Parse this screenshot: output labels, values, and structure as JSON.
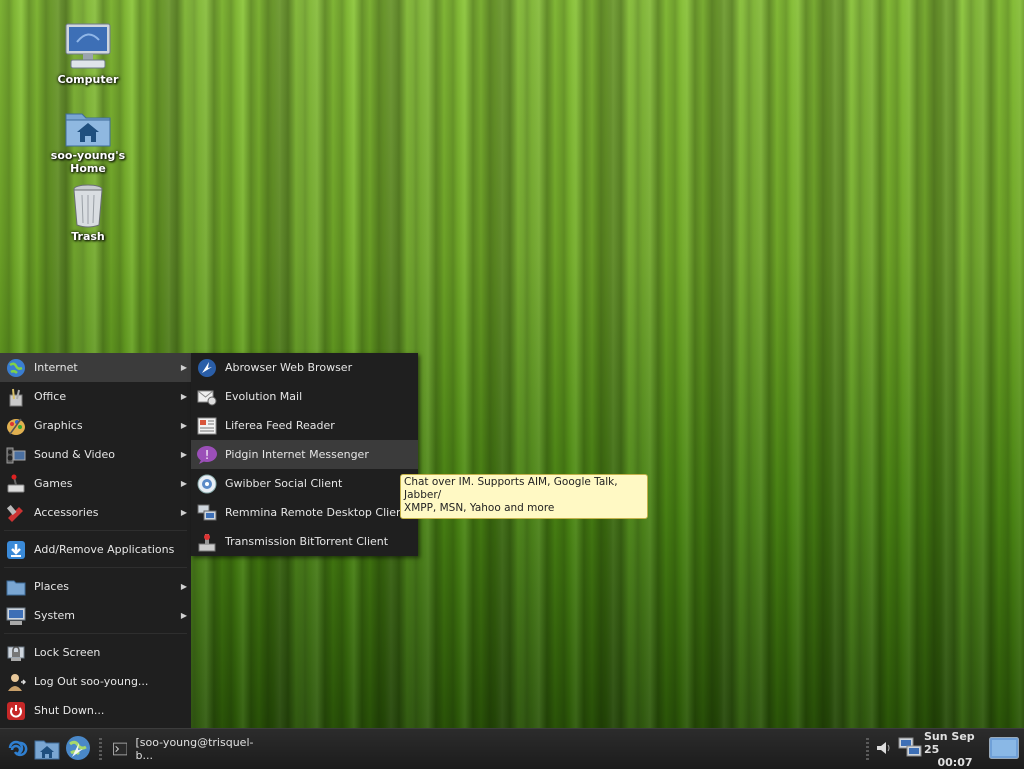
{
  "desktop": {
    "icons": [
      {
        "label": "Computer",
        "icon": "computer-icon"
      },
      {
        "label": "soo-young's Home",
        "icon": "home-folder-icon"
      },
      {
        "label": "Trash",
        "icon": "trash-icon"
      }
    ]
  },
  "main_menu": {
    "items": [
      {
        "label": "Internet",
        "icon": "globe-icon",
        "has_submenu": true
      },
      {
        "label": "Office",
        "icon": "office-icon",
        "has_submenu": true
      },
      {
        "label": "Graphics",
        "icon": "graphics-icon",
        "has_submenu": true
      },
      {
        "label": "Sound & Video",
        "icon": "sound-video-icon",
        "has_submenu": true
      },
      {
        "label": "Games",
        "icon": "games-icon",
        "has_submenu": true
      },
      {
        "label": "Accessories",
        "icon": "accessories-icon",
        "has_submenu": true
      },
      {
        "label": "Add/Remove Applications",
        "icon": "add-remove-icon",
        "has_submenu": false
      },
      {
        "label": "Places",
        "icon": "places-folder-icon",
        "has_submenu": true
      },
      {
        "label": "System",
        "icon": "system-icon",
        "has_submenu": true
      },
      {
        "label": "Lock Screen",
        "icon": "lock-icon",
        "has_submenu": false
      },
      {
        "label": "Log Out soo-young...",
        "icon": "logout-icon",
        "has_submenu": false
      },
      {
        "label": "Shut Down...",
        "icon": "shutdown-icon",
        "has_submenu": false
      }
    ]
  },
  "submenu": {
    "items": [
      {
        "label": "Abrowser Web Browser",
        "icon": "browser-icon"
      },
      {
        "label": "Evolution Mail",
        "icon": "mail-icon"
      },
      {
        "label": "Liferea Feed Reader",
        "icon": "feed-icon"
      },
      {
        "label": "Pidgin Internet Messenger",
        "icon": "pidgin-icon"
      },
      {
        "label": "Gwibber Social Client",
        "icon": "gwibber-icon"
      },
      {
        "label": "Remmina Remote Desktop Client",
        "icon": "remote-desktop-icon"
      },
      {
        "label": "Transmission BitTorrent Client",
        "icon": "torrent-icon"
      }
    ]
  },
  "tooltip": {
    "line1": "Chat over IM.  Supports AIM, Google Talk, Jabber/",
    "line2": "XMPP, MSN, Yahoo and more"
  },
  "taskbar": {
    "window_label": "[soo-young@trisquel-b...",
    "clock_date": "Sun Sep 25",
    "clock_time": "00:07"
  },
  "colors": {
    "menu_bg": "#1f1f1f",
    "menu_highlight": "#3b3b3b",
    "tooltip_bg": "#fff9c4",
    "desktop_green": "#76b02a"
  }
}
